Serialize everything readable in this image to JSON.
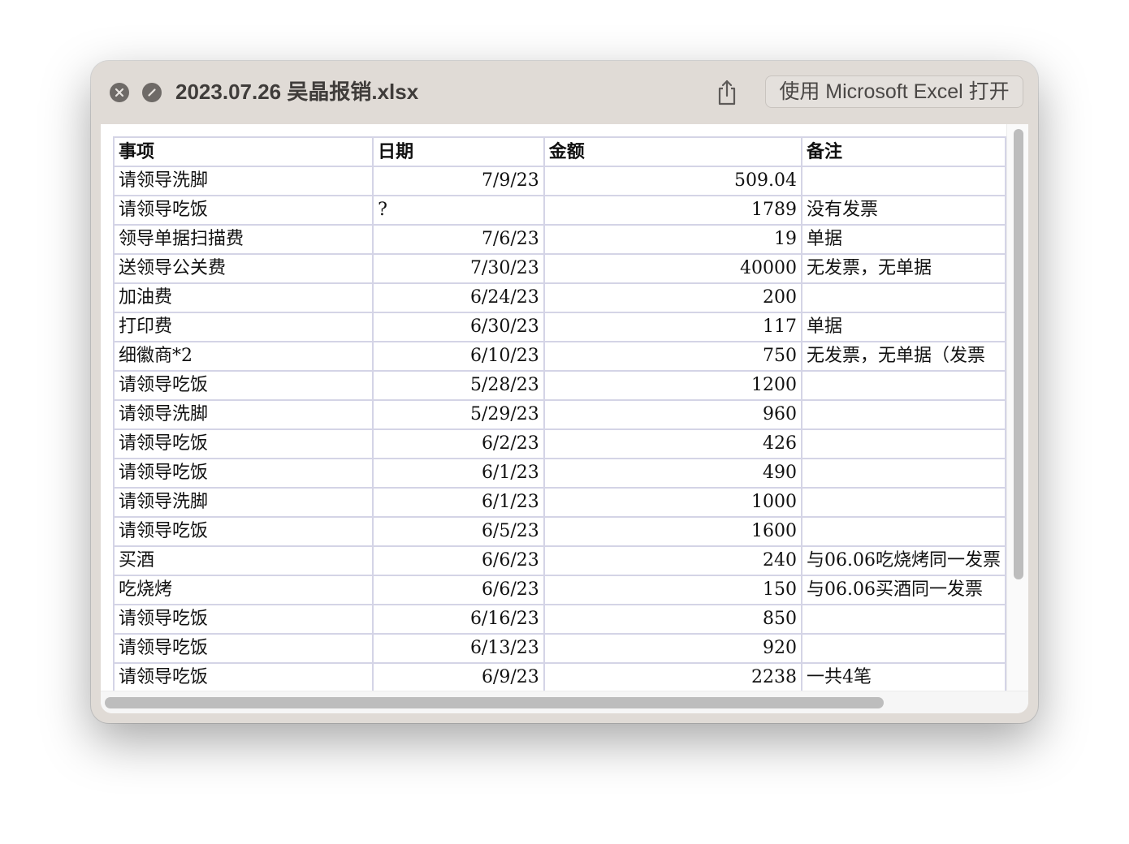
{
  "window": {
    "title": "2023.07.26 吴晶报销.xlsx",
    "open_with_label": "使用 Microsoft Excel 打开",
    "close_icon": "close-icon",
    "fullscreen_icon": "fullscreen-icon",
    "share_icon": "share-icon"
  },
  "sheet": {
    "headers": [
      "事项",
      "日期",
      "金额",
      "备注"
    ],
    "rows": [
      [
        "请领导洗脚",
        "7/9/23",
        "509.04",
        ""
      ],
      [
        "请领导吃饭",
        "?",
        "1789",
        "没有发票"
      ],
      [
        "领导单据扫描费",
        "7/6/23",
        "19",
        "单据"
      ],
      [
        "送领导公关费",
        "7/30/23",
        "40000",
        "无发票，无单据"
      ],
      [
        "加油费",
        "6/24/23",
        "200",
        ""
      ],
      [
        "打印费",
        "6/30/23",
        "117",
        "单据"
      ],
      [
        "细徽商*2",
        "6/10/23",
        "750",
        "无发票，无单据（发票"
      ],
      [
        "请领导吃饭",
        "5/28/23",
        "1200",
        ""
      ],
      [
        "请领导洗脚",
        "5/29/23",
        "960",
        ""
      ],
      [
        "请领导吃饭",
        "6/2/23",
        "426",
        ""
      ],
      [
        "请领导吃饭",
        "6/1/23",
        "490",
        ""
      ],
      [
        "请领导洗脚",
        "6/1/23",
        "1000",
        ""
      ],
      [
        "请领导吃饭",
        "6/5/23",
        "1600",
        ""
      ],
      [
        "买酒",
        "6/6/23",
        "240",
        "与06.06吃烧烤同一发票"
      ],
      [
        "吃烧烤",
        "6/6/23",
        "150",
        "与06.06买酒同一发票"
      ],
      [
        "请领导吃饭",
        "6/16/23",
        "850",
        ""
      ],
      [
        "请领导吃饭",
        "6/13/23",
        "920",
        ""
      ],
      [
        "请领导吃饭",
        "6/9/23",
        "2238",
        "一共4笔"
      ]
    ]
  },
  "colors": {
    "window_bg": "#e0dbd6",
    "grid_line": "#d4d4e6",
    "icon": "#6e6a67"
  }
}
